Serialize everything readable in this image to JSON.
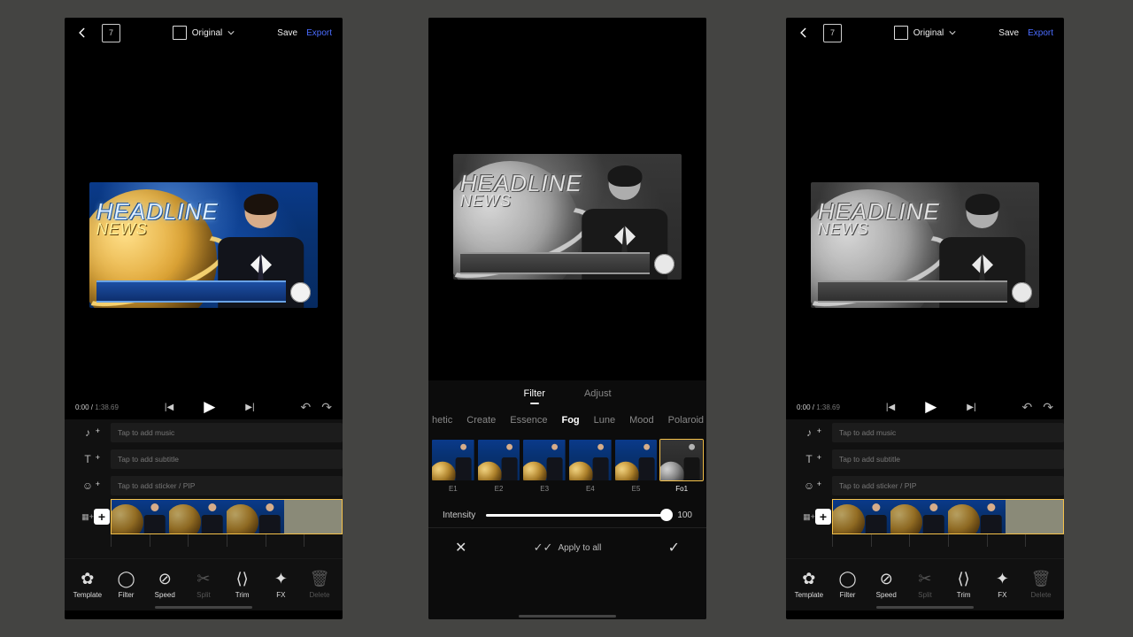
{
  "common": {
    "aspect_label": "Original",
    "save": "Save",
    "export": "Export",
    "page_badge": "7",
    "time": "0:00",
    "duration": "1:38.69"
  },
  "news": {
    "headline1": "HEADLINE",
    "headline2": "NEWS"
  },
  "timeline": {
    "music": "Tap to add music",
    "subtitle": "Tap to add subtitle",
    "sticker": "Tap to add sticker / PIP"
  },
  "toolbar": {
    "template": "Template",
    "filter": "Filter",
    "speed": "Speed",
    "split": "Split",
    "trim": "Trim",
    "fx": "FX",
    "delete": "Delete"
  },
  "filter_panel": {
    "tabs": {
      "filter": "Filter",
      "adjust": "Adjust"
    },
    "categories": [
      "hetic",
      "Create",
      "Essence",
      "Fog",
      "Lune",
      "Mood",
      "Polaroid"
    ],
    "active_category": "Fog",
    "items": [
      {
        "code": "E1"
      },
      {
        "code": "E2"
      },
      {
        "code": "E3"
      },
      {
        "code": "E4"
      },
      {
        "code": "E5"
      },
      {
        "code": "Fo1"
      }
    ],
    "intensity_label": "Intensity",
    "intensity_value": "100",
    "intensity_pct": 100,
    "apply_all": "Apply to all"
  }
}
